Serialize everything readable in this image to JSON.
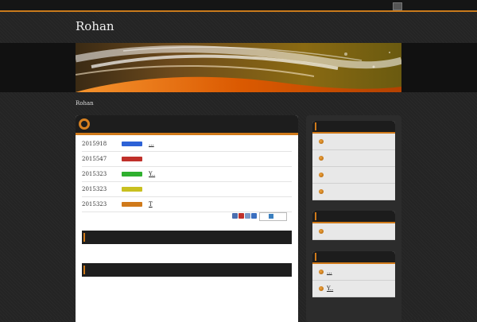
{
  "site": {
    "title": "Rohan"
  },
  "breadcrumb": {
    "text": "Rohan"
  },
  "colors": {
    "accent": "#d07a1a",
    "background": "#242424"
  },
  "news": [
    {
      "date": "2015918",
      "label_color": "#2d62d6",
      "text": "..."
    },
    {
      "date": "2015547",
      "label_color": "#c0302a",
      "text": ""
    },
    {
      "date": "2015323",
      "label_color": "#2fb02f",
      "text": "Y.."
    },
    {
      "date": "2015323",
      "label_color": "#c9c020",
      "text": ""
    },
    {
      "date": "2015323",
      "label_color": "#d07a1a",
      "text": "T"
    }
  ],
  "share_icons": [
    "bookmark-icon",
    "hatena-icon",
    "pen-icon",
    "link-icon",
    "facebook-share-icon"
  ],
  "sidebar": {
    "widget1": {
      "items": [
        "",
        "",
        "",
        ""
      ]
    },
    "widget2": {
      "items": [
        ""
      ]
    },
    "widget3": {
      "items": [
        "...",
        "Y.."
      ]
    }
  }
}
